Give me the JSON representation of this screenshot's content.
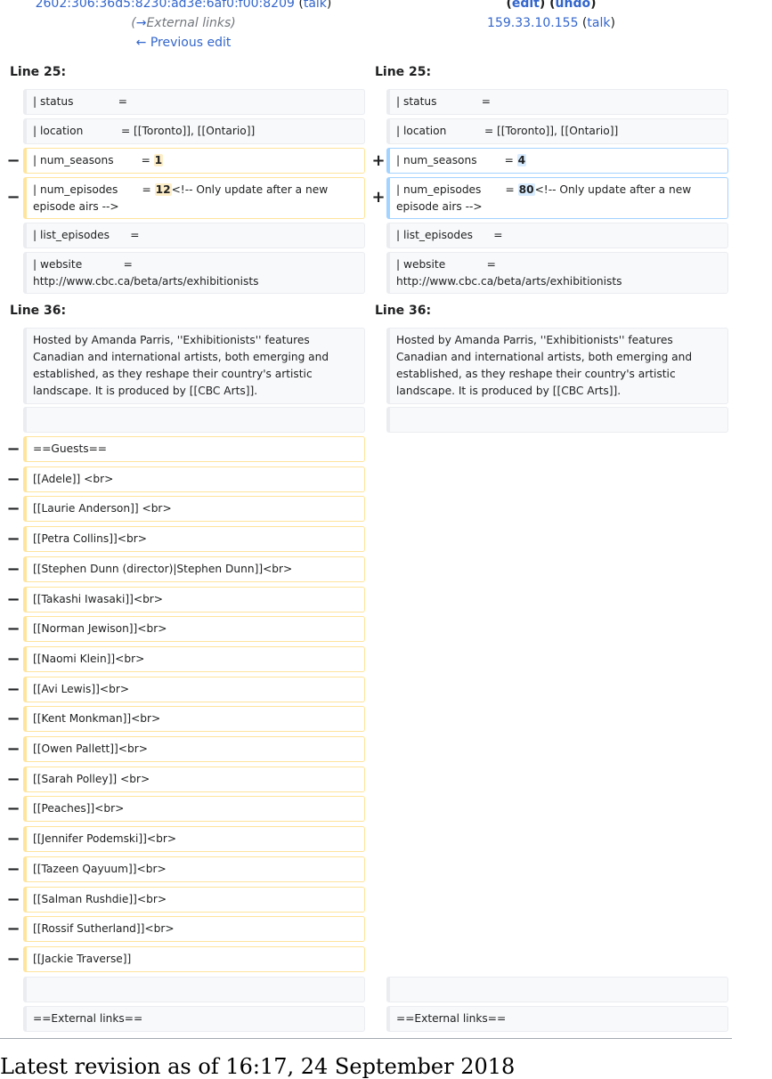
{
  "header": {
    "left": {
      "user": "2602:306:36d5:8230:ad3e:6af0:f00:8209",
      "talk": "talk",
      "summary_arrow": "→",
      "summary": "External links",
      "prev": "← Previous edit"
    },
    "right": {
      "edit": "edit",
      "undo": "undo",
      "user": "159.33.10.155",
      "talk": "talk"
    }
  },
  "section1": {
    "line_left": "Line 25:",
    "line_right": "Line 25:",
    "context": [
      {
        "left": "| status             =",
        "right": "| status             ="
      },
      {
        "left": "| location           = [[Toronto]], [[Ontario]]",
        "right": "| location           = [[Toronto]], [[Ontario]]"
      }
    ],
    "changes": [
      {
        "del_pre": "| num_seasons        = ",
        "del_word": "1",
        "del_post": "",
        "add_pre": "| num_seasons        = ",
        "add_word": "4",
        "add_post": ""
      },
      {
        "del_pre": "| num_episodes       = ",
        "del_word": "12",
        "del_post": "<!-- Only update after a new episode airs -->",
        "add_pre": "| num_episodes       = ",
        "add_word": "80",
        "add_post": "<!-- Only update after a new episode airs -->"
      }
    ],
    "context_after": [
      {
        "left": "| list_episodes      =",
        "right": "| list_episodes      ="
      },
      {
        "left": "| website            = http://www.cbc.ca/beta/arts/exhibitionists",
        "right": "| website            = http://www.cbc.ca/beta/arts/exhibitionists"
      }
    ]
  },
  "section2": {
    "line_left": "Line 36:",
    "line_right": "Line 36:",
    "paragraph": "Hosted by Amanda Parris, ''Exhibitionists'' features Canadian and international artists, both emerging and established, as they reshape their country's artistic landscape. It is produced by [[CBC Arts]].",
    "removed": [
      "==Guests==",
      "[[Adele]] <br>",
      "[[Laurie Anderson]] <br>",
      "[[Petra Collins]]<br>",
      "[[Stephen Dunn (director)|Stephen Dunn]]<br>",
      "[[Takashi Iwasaki]]<br>",
      "[[Norman Jewison]]<br>",
      "[[Naomi Klein]]<br>",
      "[[Avi Lewis]]<br>",
      "[[Kent Monkman]]<br>",
      "[[Owen Pallett]]<br>",
      "[[Sarah Polley]] <br>",
      "[[Peaches]]<br>",
      "[[Jennifer Podemski]]<br>",
      "[[Tazeen Qayuum]]<br>",
      "[[Salman Rushdie]]<br>",
      "[[Rossif Sutherland]]<br>",
      "[[Jackie Traverse]]"
    ],
    "external_left": "==External links==",
    "external_right": "==External links=="
  },
  "markers": {
    "minus": "−",
    "plus": "+"
  },
  "footer": {
    "title": "Latest revision as of 16:17, 24 September 2018"
  }
}
